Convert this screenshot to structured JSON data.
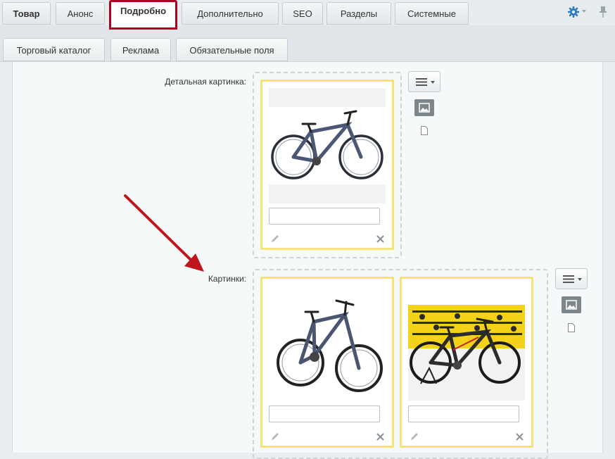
{
  "tabs_row1": [
    {
      "label": "Товар"
    },
    {
      "label": "Анонс"
    },
    {
      "label": "Подробно"
    },
    {
      "label": "Дополнительно"
    },
    {
      "label": "SEO"
    },
    {
      "label": "Разделы"
    },
    {
      "label": "Системные"
    }
  ],
  "tabs_row2": [
    {
      "label": "Торговый каталог"
    },
    {
      "label": "Реклама"
    },
    {
      "label": "Обязательные поля"
    }
  ],
  "active_tab": "Подробно",
  "toolbar_icons": [
    "gear-icon",
    "pin-icon"
  ],
  "fields": {
    "detail_picture": {
      "label": "Детальная картинка:",
      "images": [
        {
          "description": "",
          "picture": "bicycle"
        }
      ]
    },
    "pictures": {
      "label": "Картинки:",
      "images": [
        {
          "description": "",
          "picture": "bicycle"
        },
        {
          "description": "",
          "picture": "bicycle-in-shop"
        }
      ]
    }
  },
  "colors": {
    "active_tab_border": "#b00020",
    "card_border": "#f5e37a",
    "arrow": "#c0151c",
    "gear": "#2a7bc0"
  }
}
